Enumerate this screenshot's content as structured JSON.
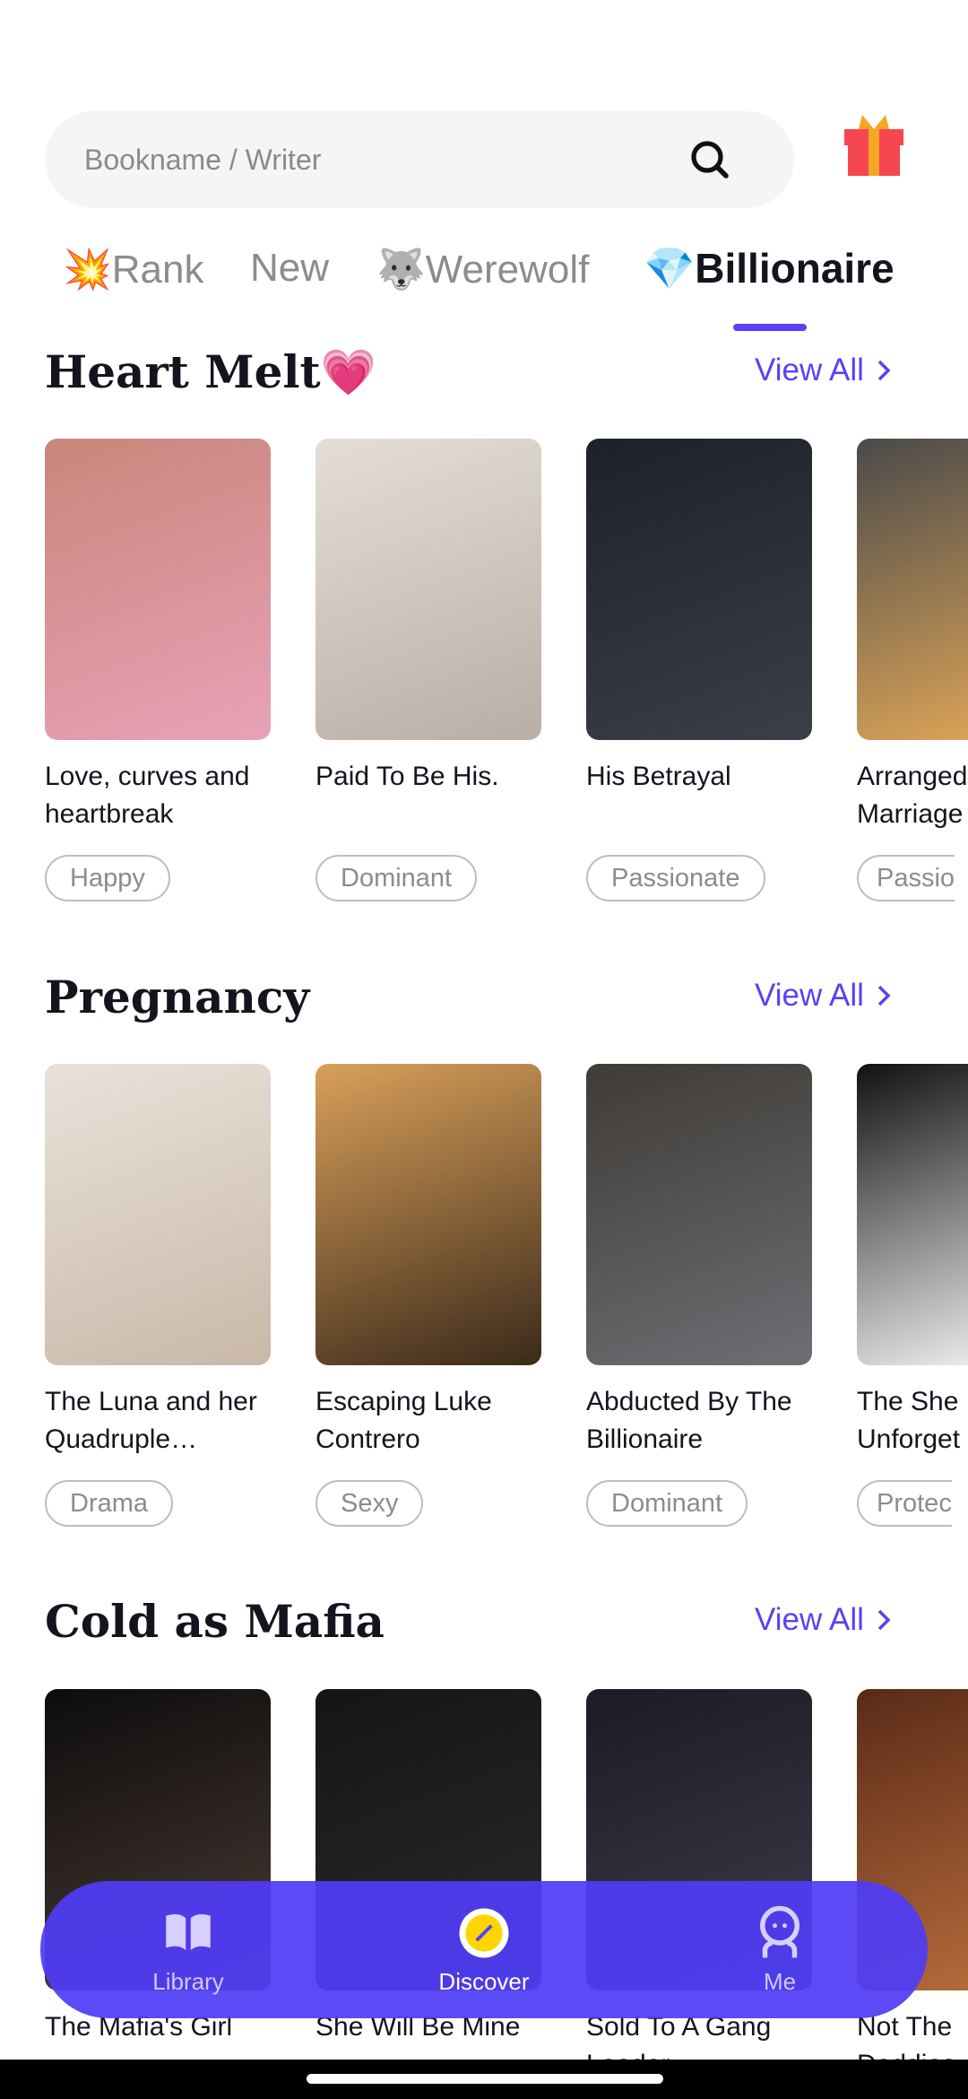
{
  "search": {
    "placeholder": "Bookname / Writer"
  },
  "tabs": [
    {
      "label": "💥Rank"
    },
    {
      "label": "New"
    },
    {
      "label": "🐺Werewolf"
    },
    {
      "label": "💎Billionaire",
      "active": true
    }
  ],
  "accent": "#5842f5",
  "sections": [
    {
      "title": "Heart Melt💗",
      "view_all": "View All",
      "books": [
        {
          "title": "Love, curves and heartbreak",
          "tag": "Happy",
          "colors": [
            "#c9867a",
            "#e8a2b8"
          ]
        },
        {
          "title": "Paid To Be His.",
          "tag": "Dominant",
          "colors": [
            "#e4ded8",
            "#b9aea5"
          ]
        },
        {
          "title": "His Betrayal",
          "tag": "Passionate",
          "colors": [
            "#1d2129",
            "#3a3f48"
          ]
        },
        {
          "title": "Arranged Marriage",
          "tag": "Passio",
          "colors": [
            "#4a4a4a",
            "#d9a257"
          ]
        }
      ]
    },
    {
      "title": "Pregnancy",
      "view_all": "View All",
      "books": [
        {
          "title": "The Luna and her Quadruple…",
          "tag": "Drama",
          "colors": [
            "#e9e2da",
            "#c9b8a8"
          ]
        },
        {
          "title": "Escaping Luke Contrero",
          "tag": "Sexy",
          "colors": [
            "#d9a05a",
            "#3b2a1a"
          ]
        },
        {
          "title": "Abducted By The Billionaire",
          "tag": "Dominant",
          "colors": [
            "#3f3b36",
            "#6d6f74"
          ]
        },
        {
          "title": "The She Unforget",
          "tag": "Protec",
          "colors": [
            "#111",
            "#e9e9e9"
          ]
        }
      ]
    },
    {
      "title": "Cold as Mafia",
      "view_all": "View All",
      "books": [
        {
          "title": "The Mafia's Girl",
          "tag": "",
          "colors": [
            "#0d0d0d",
            "#4a3a34"
          ]
        },
        {
          "title": "She Will Be Mine",
          "tag": "",
          "colors": [
            "#151515",
            "#2b2b2b"
          ]
        },
        {
          "title": "Sold To A Gang Leader",
          "tag": "",
          "colors": [
            "#1d1b26",
            "#403a48"
          ]
        },
        {
          "title": "Not The Daddies",
          "tag": "",
          "colors": [
            "#5a2a18",
            "#b46a3a"
          ]
        }
      ]
    }
  ],
  "nav": [
    {
      "label": "Library",
      "icon": "book-icon"
    },
    {
      "label": "Discover",
      "icon": "compass-icon",
      "active": true
    },
    {
      "label": "Me",
      "icon": "person-icon"
    }
  ]
}
